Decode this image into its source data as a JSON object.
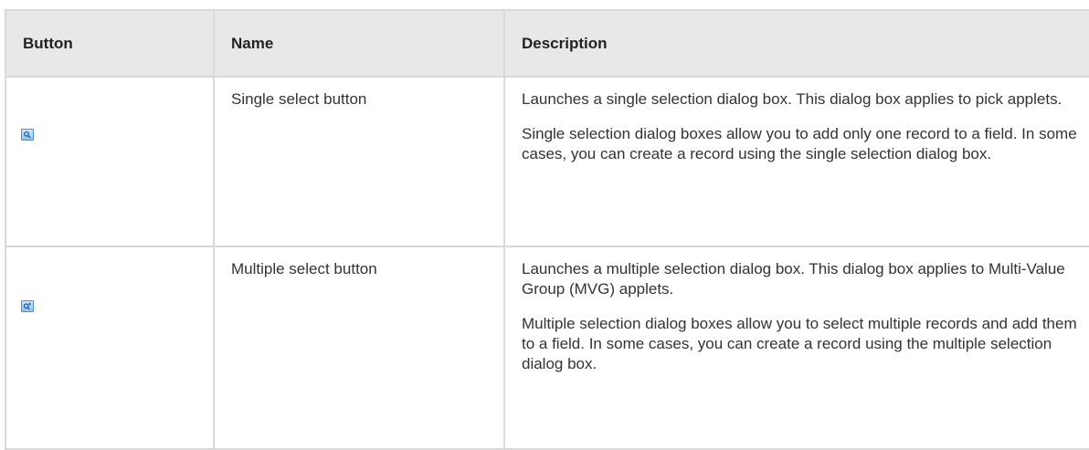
{
  "table": {
    "headers": [
      "Button",
      "Name",
      "Description"
    ],
    "rows": [
      {
        "icon": "magnifier-icon",
        "name": "Single select button",
        "description": [
          "Launches a single selection dialog box. This dialog box applies to pick applets.",
          "Single selection dialog boxes allow you to add only one record to a field. In some cases, you can create a record using the single selection dialog box."
        ]
      },
      {
        "icon": "magnifier-plus-icon",
        "name": "Multiple select button",
        "description": [
          "Launches a multiple selection dialog box. This dialog box applies to Multi-Value Group (MVG) applets.",
          "Multiple selection dialog boxes allow you to select multiple records and add them to a field. In some cases, you can create a record using the multiple selection dialog box."
        ]
      }
    ]
  }
}
